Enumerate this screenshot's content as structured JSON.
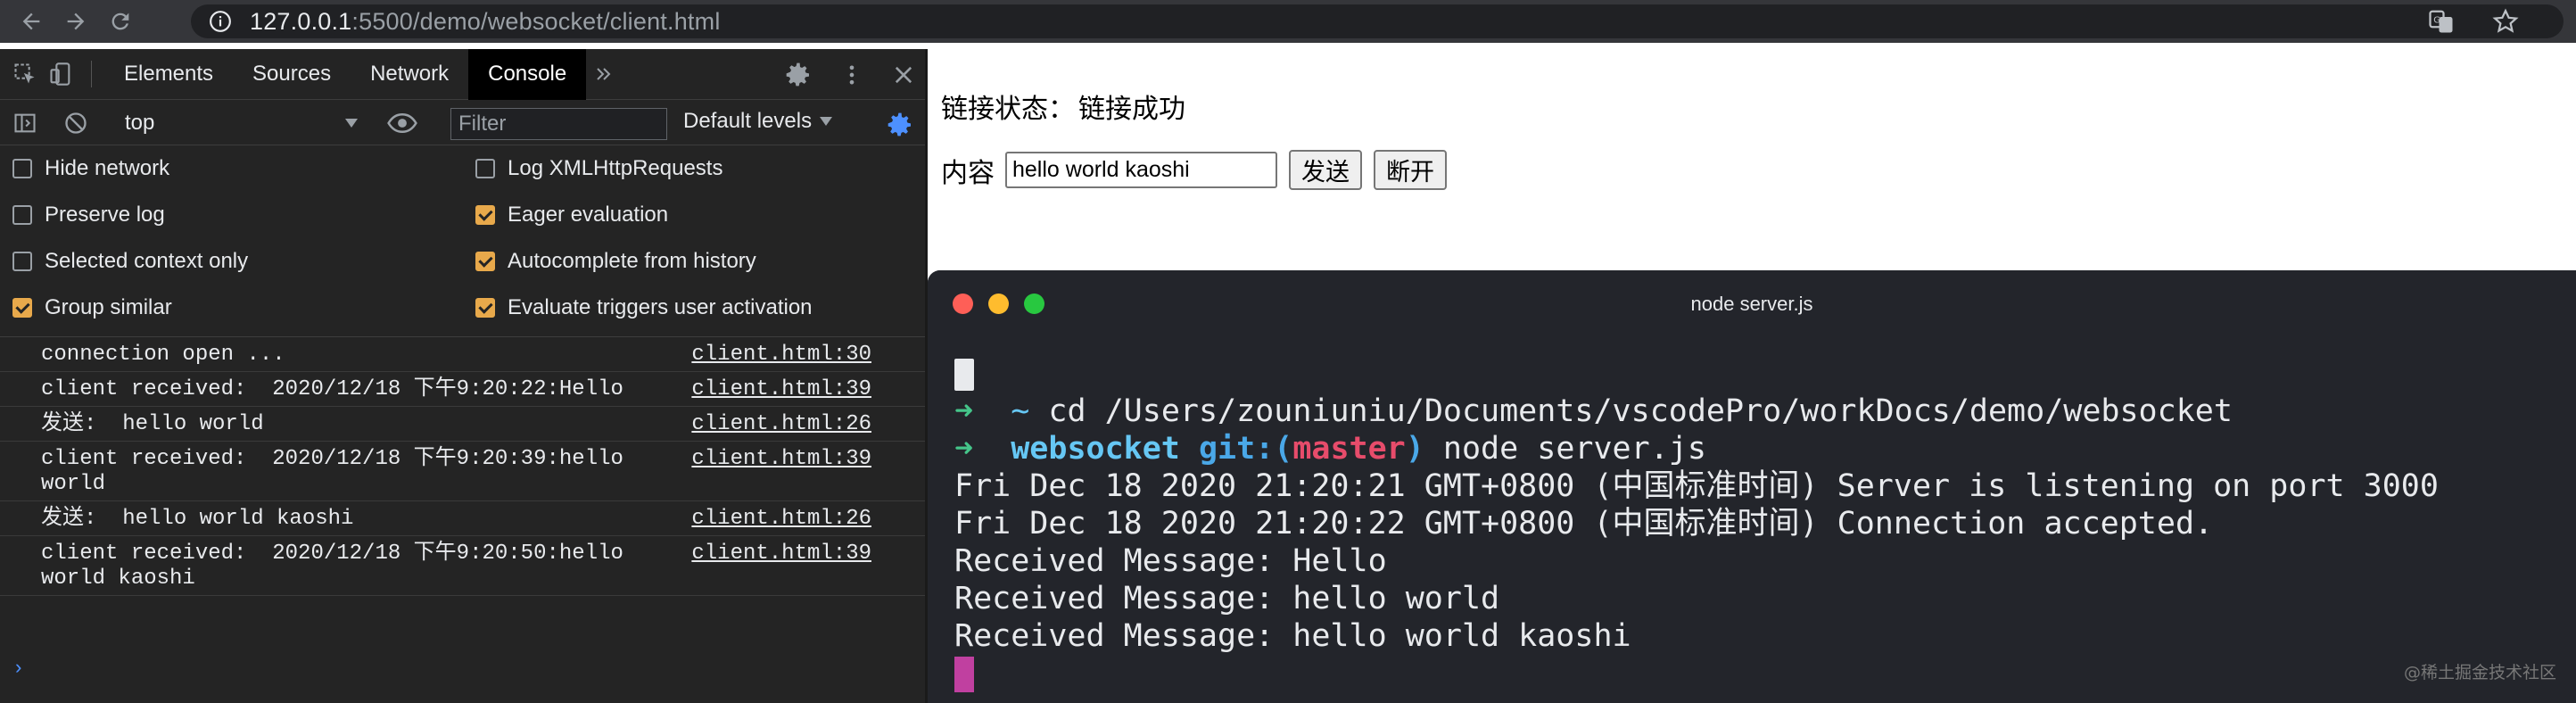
{
  "browser": {
    "url_host": "127.0.0.1",
    "url_path": ":5500/demo/websocket/client.html"
  },
  "devtools": {
    "tabs": [
      "Elements",
      "Sources",
      "Network",
      "Console"
    ],
    "active_tab": "Console",
    "context": "top",
    "filter_placeholder": "Filter",
    "levels_label": "Default levels",
    "options": [
      {
        "label": "Hide network",
        "checked": false
      },
      {
        "label": "Log XMLHttpRequests",
        "checked": false
      },
      {
        "label": "Preserve log",
        "checked": false
      },
      {
        "label": "Eager evaluation",
        "checked": true
      },
      {
        "label": "Selected context only",
        "checked": false
      },
      {
        "label": "Autocomplete from history",
        "checked": true
      },
      {
        "label": "Group similar",
        "checked": true
      },
      {
        "label": "Evaluate triggers user activation",
        "checked": true
      }
    ],
    "logs": [
      {
        "message": "connection open ...",
        "source": "client.html:30"
      },
      {
        "message": "client received:  2020/12/18 下午9:20:22:Hello",
        "source": "client.html:39"
      },
      {
        "message": "发送:  hello world",
        "source": "client.html:26"
      },
      {
        "message": "client received:  2020/12/18 下午9:20:39:hello world",
        "source": "client.html:39"
      },
      {
        "message": "发送:  hello world kaoshi",
        "source": "client.html:26"
      },
      {
        "message": "client received:  2020/12/18 下午9:20:50:hello world kaoshi",
        "source": "client.html:39"
      }
    ],
    "prompt": "›"
  },
  "page": {
    "status_label": "链接状态：",
    "status_value": "链接成功",
    "content_label": "内容",
    "input_value": "hello world kaoshi",
    "send_button": "发送",
    "disconnect_button": "断开"
  },
  "terminal": {
    "title": "node server.js",
    "line_cd_cmd": "cd /Users/zouniuniu/Documents/vscodePro/workDocs/demo/websocket",
    "line2_dir": "websocket",
    "line2_git": "git:(",
    "line2_branch": "master",
    "line2_git_close": ")",
    "line2_cmd": " node server.js",
    "output": [
      "Fri Dec 18 2020 21:20:21 GMT+0800 (中国标准时间) Server is listening on port 3000",
      "Fri Dec 18 2020 21:20:22 GMT+0800 (中国标准时间) Connection accepted.",
      "Received Message: Hello",
      "Received Message: hello world",
      "Received Message: hello world kaoshi"
    ],
    "watermark": "@稀土掘金技术社区"
  },
  "colors": {
    "devtools_bg": "#242424",
    "terminal_bg": "#23252b",
    "checkbox_on": "#e8a94b",
    "prompt_arrow": "#45c58a"
  }
}
